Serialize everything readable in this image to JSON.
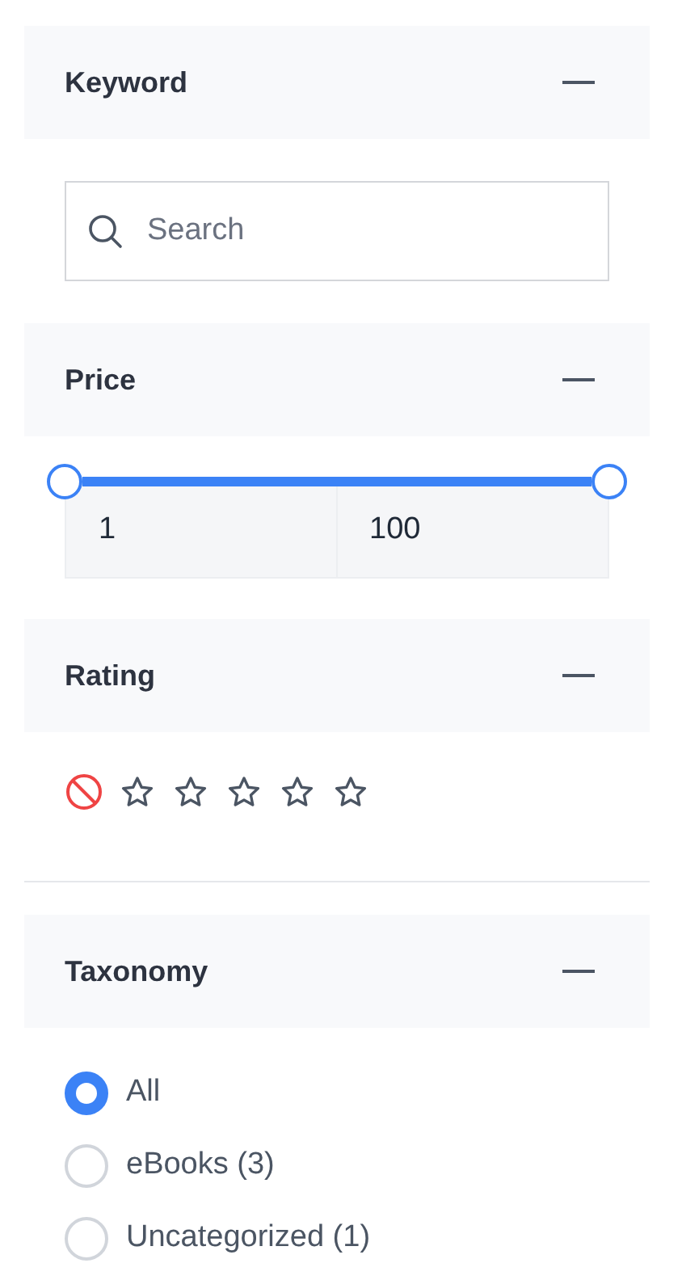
{
  "sections": [
    {
      "kind": "search",
      "title": "Keyword",
      "expanded": true,
      "search": {
        "placeholder": "Search"
      }
    },
    {
      "kind": "range",
      "title": "Price",
      "expanded": true,
      "min_value": "1",
      "max_value": "100"
    },
    {
      "kind": "rating",
      "title": "Rating",
      "expanded": true,
      "stars": 0,
      "divider": true
    },
    {
      "kind": "radio",
      "title": "Taxonomy",
      "expanded": true,
      "options": [
        {
          "label": "All",
          "selected": true
        },
        {
          "label": "eBooks (3)",
          "selected": false
        },
        {
          "label": "Uncategorized (1)",
          "selected": false
        }
      ]
    }
  ]
}
